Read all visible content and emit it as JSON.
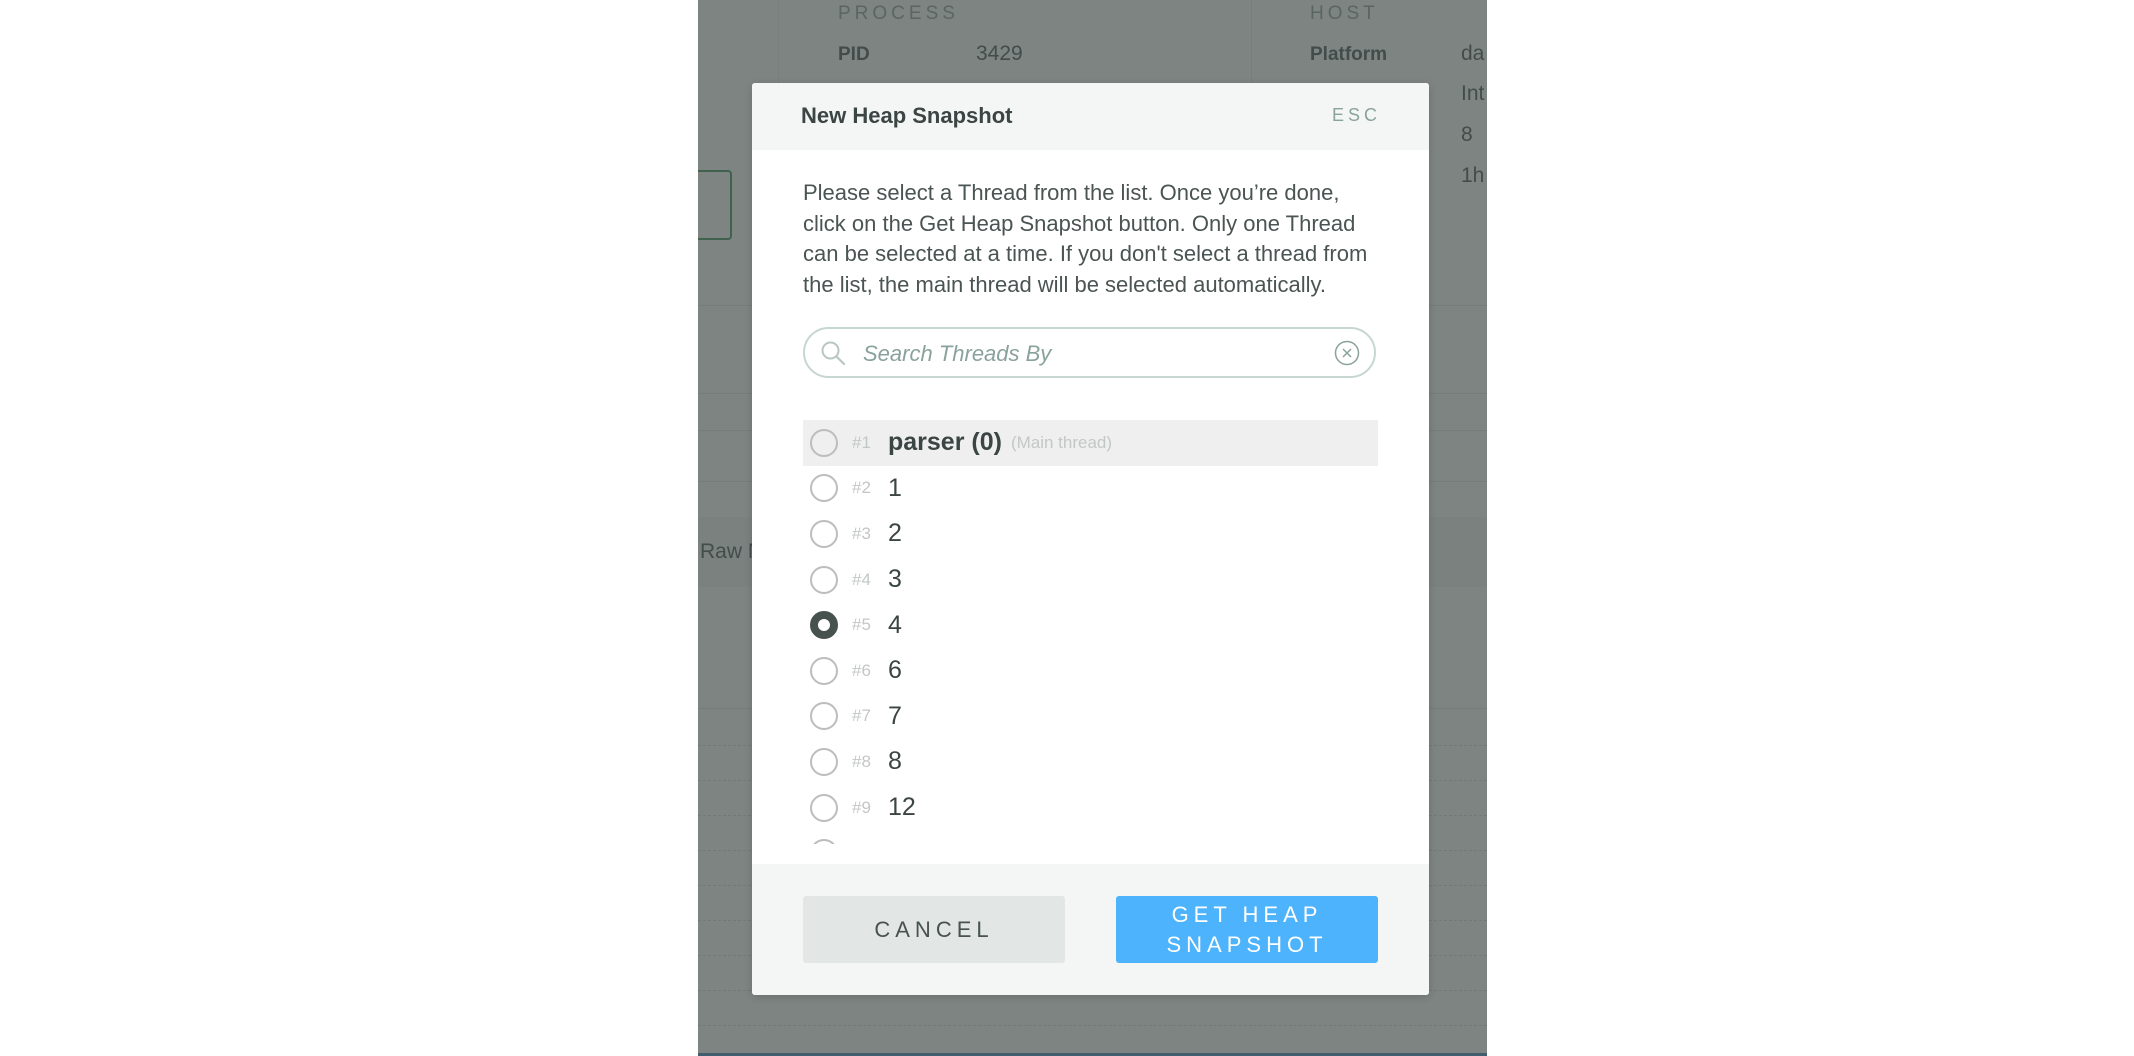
{
  "background": {
    "process": {
      "section_label": "PROCESS",
      "pid_label": "PID",
      "pid_value": "3429"
    },
    "host": {
      "section_label": "HOST",
      "platform_label": "Platform",
      "values": [
        "da",
        "Int",
        "8",
        "1h"
      ]
    },
    "partial_text": "Raw N"
  },
  "modal": {
    "title": "New Heap Snapshot",
    "esc_label": "ESC",
    "description": "Please select a Thread from the list. Once you’re done, click on the Get Heap Snapshot button. Only one Thread can be selected at a time. If you don't select a thread from the list, the main thread will be selected automatically.",
    "search": {
      "placeholder": "Search Threads By",
      "value": "",
      "icon": "search-icon",
      "clear_icon": "clear-circle-icon"
    },
    "threads": [
      {
        "index": "#1",
        "name": "parser (0)",
        "tag": "(Main thread)",
        "selected": false,
        "highlighted": true
      },
      {
        "index": "#2",
        "name": "1",
        "tag": "",
        "selected": false
      },
      {
        "index": "#3",
        "name": "2",
        "tag": "",
        "selected": false
      },
      {
        "index": "#4",
        "name": "3",
        "tag": "",
        "selected": false
      },
      {
        "index": "#5",
        "name": "4",
        "tag": "",
        "selected": true
      },
      {
        "index": "#6",
        "name": "6",
        "tag": "",
        "selected": false
      },
      {
        "index": "#7",
        "name": "7",
        "tag": "",
        "selected": false
      },
      {
        "index": "#8",
        "name": "8",
        "tag": "",
        "selected": false
      },
      {
        "index": "#9",
        "name": "12",
        "tag": "",
        "selected": false
      }
    ],
    "footer": {
      "cancel_label": "CANCEL",
      "primary_label": "GET HEAP SNAPSHOT"
    }
  },
  "colors": {
    "primary": "#4db3fc",
    "esc": "#8aa29c",
    "selected_radio": "#47524f"
  }
}
